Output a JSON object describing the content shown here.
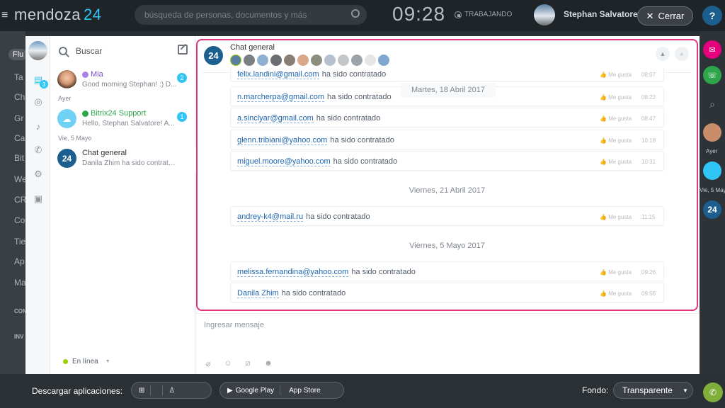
{
  "portal": {
    "logo_text": "mendoza",
    "logo_num": "24",
    "search_placeholder": "búsqueda de personas, documentos y más",
    "clock": "09:28",
    "work_status": "TRABAJANDO",
    "user_name": "Stephan Salvatore",
    "close_label": "Cerrar",
    "help_label": "?",
    "left_menu": [
      "Flu",
      "Ta",
      "Ch",
      "Gr",
      "Ca",
      "Bit",
      "We",
      "CR",
      "Co",
      "Tie",
      "Ap",
      "Ma",
      "CON",
      "INV"
    ],
    "right_labels": [
      "Ayer",
      "Vie, 5 May"
    ]
  },
  "sidebar": {
    "search_placeholder": "Buscar",
    "nav_badge": "3",
    "status_label": "En línea"
  },
  "recent": {
    "items": [
      {
        "title": "Mia",
        "subtitle": "Good morning Stephan! :) D...",
        "badge": "2"
      },
      {
        "title": "Bitrix24 Support",
        "subtitle": "Hello, Stephan Salvatore! A...",
        "badge": "1"
      },
      {
        "title": "Chat general",
        "subtitle": "Danila Zhim ha sido contratado",
        "badge": ""
      }
    ],
    "section_yesterday": "Ayer",
    "section_friday": "Vie, 5 Mayo"
  },
  "chat": {
    "avatar_text": "24",
    "title": "Chat general",
    "date_floating": "Martes, 18 Abril 2017",
    "date_apr21": "Viernes, 21 Abril 2017",
    "date_may5": "Viernes, 5 Mayo 2017",
    "like_label": "Me gusta",
    "hired_text": "ha sido contratado",
    "messages": [
      {
        "email": "felix.landini@gmail.com",
        "time": "08:07"
      },
      {
        "email": "n.marcherpa@gmail.com",
        "time": "08:22"
      },
      {
        "email": "a.sinclyar@gmail.com",
        "time": "08:47"
      },
      {
        "email": "glenn.tribiani@yahoo.com",
        "time": "10:18"
      },
      {
        "email": "miguel.moore@yahoo.com",
        "time": "10:31"
      },
      {
        "email": "andrey-k4@mail.ru",
        "time": "11:15"
      },
      {
        "email": "melissa.fernandina@yahoo.com",
        "time": "09:26"
      },
      {
        "email": "Danila Zhim",
        "time": "09:56"
      }
    ],
    "input_placeholder": "Ingresar mensaje"
  },
  "bottom": {
    "download_label": "Descargar aplicaciones:",
    "google_play": "Google Play",
    "app_store": "App Store",
    "fondo_label": "Fondo:",
    "fondo_value": "Transparente"
  },
  "colors": {
    "accent": "#2fc6f6",
    "highlight": "#e0347c",
    "bitrix_blue": "#1c5f8e",
    "support_green": "#2fa54b",
    "online_green": "#9dcf00"
  }
}
